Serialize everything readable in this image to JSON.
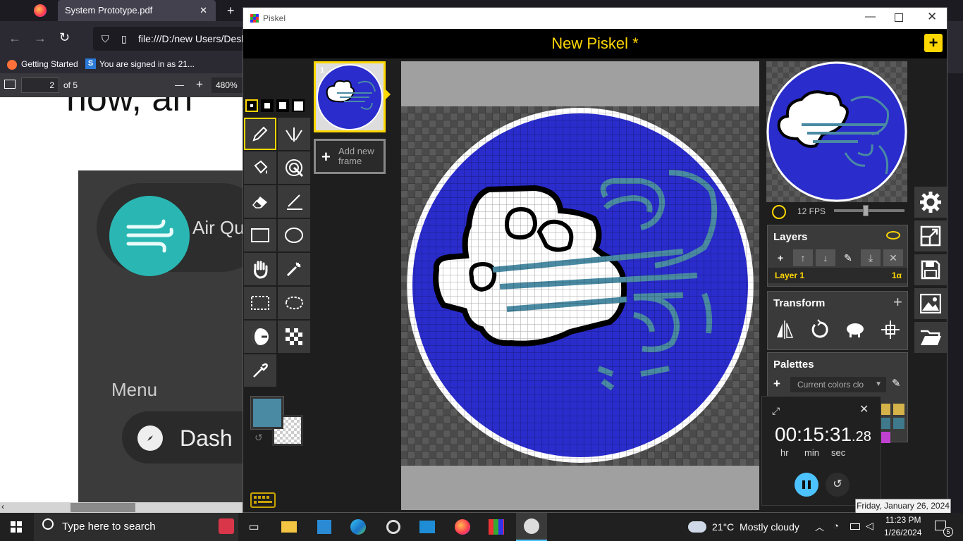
{
  "browser": {
    "tab_title": "System Prototype.pdf",
    "new_tab": "+",
    "url": "file:///D:/new Users/Desk",
    "bookmarks": [
      "Getting Started",
      "You are signed in as 21..."
    ],
    "pdf_toolbar": {
      "page_value": "2",
      "page_total": "of 5",
      "zoom": "480%",
      "zoom_out": "—",
      "zoom_in": "+"
    },
    "pdf_content": {
      "heading_fragment": "now, an",
      "brand_label": "Air Qu",
      "menu_label": "Menu",
      "dash_label": "Dash"
    }
  },
  "piskel": {
    "window_title": "Piskel",
    "doc_title": "New Piskel *",
    "add_frame": "Add new frame",
    "frame_index": "1",
    "fps_label": "12 FPS",
    "fps_value": 0.45,
    "layers": {
      "title": "Layers",
      "layer_name": "Layer 1",
      "opacity": "1α"
    },
    "transform": {
      "title": "Transform"
    },
    "palettes": {
      "title": "Palettes",
      "selected": "Current colors clo"
    },
    "colors": {
      "primary": "#4a8aa3",
      "accent": "#ffd700",
      "canvas_fill": "#2a2ccc",
      "swatches": [
        "#d6b34a",
        "#d6b34a",
        "#3f7a8c",
        "#3f7a8c",
        "#c040d0"
      ]
    },
    "tools": [
      "pen-icon",
      "vertical-mirror-icon",
      "paint-bucket-icon",
      "spray-icon",
      "eraser-icon",
      "stroke-icon",
      "rectangle-icon",
      "circle-icon",
      "move-hand-icon",
      "shape-select-icon",
      "rectangle-select-icon",
      "lasso-select-icon",
      "lighten-icon",
      "dithering-icon",
      "color-picker-icon"
    ]
  },
  "clock": {
    "hours": "00",
    "minutes": "15",
    "seconds": "31",
    "fraction": ".28",
    "hr_label": "hr",
    "min_label": "min",
    "sec_label": "sec"
  },
  "taskbar": {
    "search_placeholder": "Type here to search",
    "weather": "21°C  Mostly cloudy",
    "time": "11:23 PM",
    "date": "1/26/2024",
    "tooltip": "Friday, January 26, 2024",
    "notifications": "5"
  }
}
